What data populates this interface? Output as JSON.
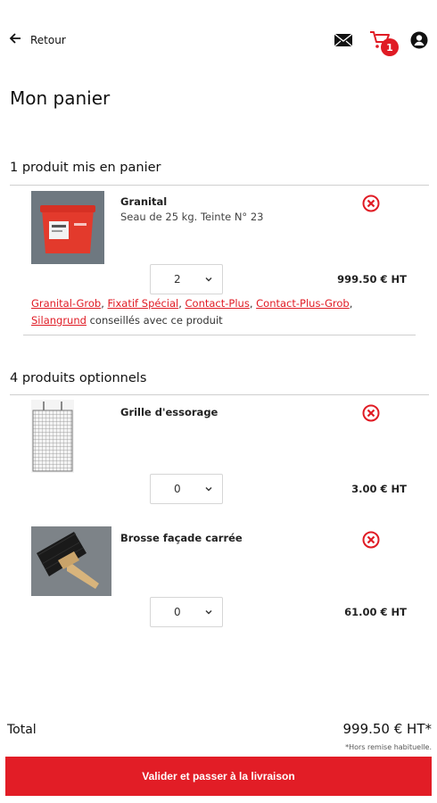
{
  "header": {
    "back_label": "Retour",
    "cart_count": "1"
  },
  "page_title": "Mon panier",
  "cart_section": {
    "title": "1 produit mis en panier",
    "items": [
      {
        "name": "Granital",
        "description": "Seau de 25 kg. Teinte N° 23",
        "quantity": "2",
        "price": "999.50 € HT"
      }
    ],
    "recommendations": {
      "links": [
        "Granital-Grob",
        "Fixatif Spécial",
        "Contact-Plus",
        "Contact-Plus-Grob",
        "Silangrund"
      ],
      "suffix": "conseillés avec ce produit"
    }
  },
  "optional_section": {
    "title": "4 produits optionnels",
    "items": [
      {
        "name": "Grille d'essorage",
        "quantity": "0",
        "price": "3.00 € HT"
      },
      {
        "name": "Brosse façade carrée",
        "quantity": "0",
        "price": "61.00 € HT"
      }
    ]
  },
  "footer": {
    "total_label": "Total",
    "total_value": "999.50 € HT*",
    "total_note": "*Hors remise habituelle.",
    "cta_label": "Valider et passer à la livraison"
  },
  "colors": {
    "accent": "#e01b24",
    "divider": "#cfcfcf"
  },
  "icons": [
    "back-arrow-icon",
    "mail-icon",
    "cart-icon",
    "account-icon",
    "remove-icon",
    "chevron-down-icon"
  ]
}
